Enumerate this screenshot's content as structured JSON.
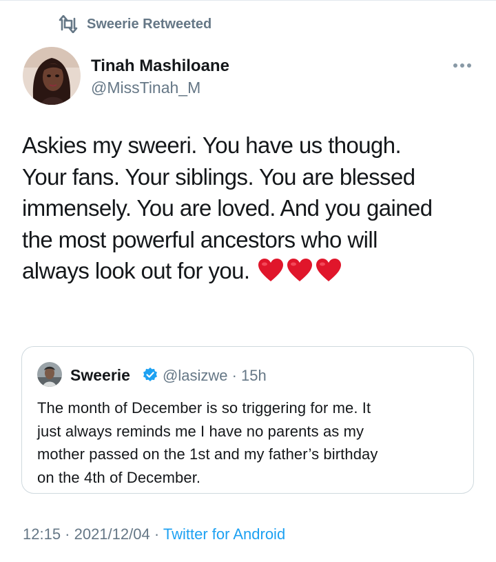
{
  "retweet": {
    "label": "Sweerie Retweeted",
    "icon": "retweet-icon"
  },
  "author": {
    "name": "Tinah Mashiloane",
    "handle": "@MissTinah_M"
  },
  "tweet": {
    "lines": [
      "Askies my sweeri. You have us though.",
      "Your fans. Your siblings. You are blessed",
      "immensely. You are loved. And you gained",
      "the most powerful ancestors who will",
      "always look out for you."
    ],
    "emoji": [
      "heart-icon",
      "heart-icon",
      "heart-icon"
    ]
  },
  "quoted": {
    "name": "Sweerie",
    "verified": true,
    "handle": "@lasizwe · 15h",
    "lines": [
      "The month of December is so triggering for me. It",
      "just always reminds me I have no parents as my",
      "mother passed on the 1st and my father’s birthday",
      "on the 4th of December."
    ]
  },
  "meta": {
    "time_date": "12:15 · 2021/12/04 · ",
    "source": "Twitter for Android"
  },
  "colors": {
    "accent": "#1da1f2",
    "muted": "#657786",
    "heart": "#e0162b",
    "border": "#cfd9de"
  }
}
